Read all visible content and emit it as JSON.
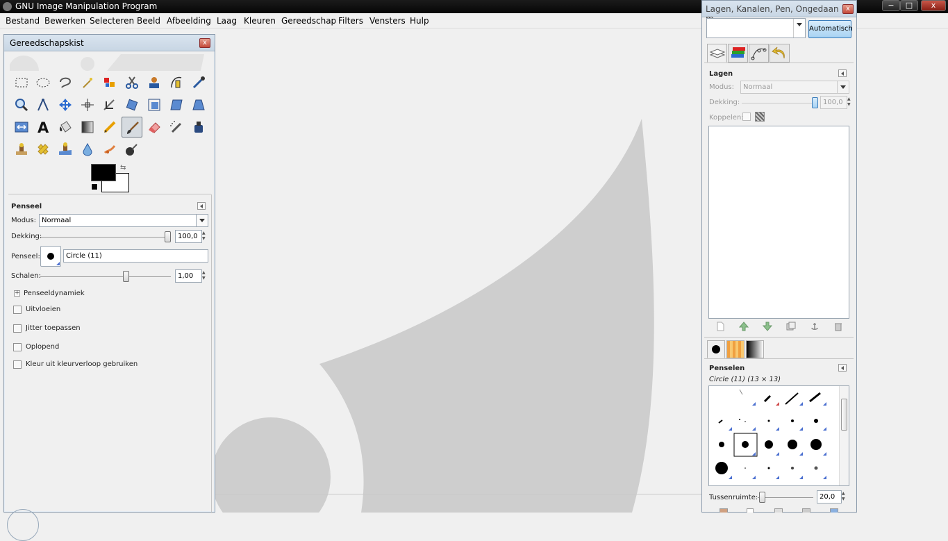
{
  "app": {
    "title": "GNU Image Manipulation Program",
    "window_buttons": {
      "min": "−",
      "max": "□",
      "close": "x"
    }
  },
  "menubar": {
    "items": [
      "Bestand",
      "Bewerken",
      "Selecteren",
      "Beeld",
      "Afbeelding",
      "Laag",
      "Kleuren",
      "Gereedschap",
      "Filters",
      "Vensters",
      "Hulp"
    ]
  },
  "toolbox": {
    "title": "Gereedschapskist",
    "close": "x",
    "active_tool": "paintbrush",
    "tools": [
      "rect-select",
      "ellipse-select",
      "free-select",
      "fuzzy-select",
      "color-select",
      "scissors-select",
      "foreground-select",
      "paths",
      "color-picker",
      "zoom",
      "measure",
      "move",
      "align",
      "crop",
      "rotate",
      "scale",
      "shear",
      "perspective",
      "flip",
      "text",
      "bucket-fill",
      "blend",
      "pencil",
      "paintbrush",
      "eraser",
      "airbrush",
      "ink",
      "clone",
      "heal",
      "perspective-clone",
      "blur-sharpen",
      "smudge",
      "dodge-burn"
    ],
    "colors": {
      "foreground": "#000000",
      "background": "#ffffff"
    }
  },
  "tool_options": {
    "title": "Penseel",
    "mode_label": "Modus:",
    "mode_value": "Normaal",
    "opacity_label": "Dekking:",
    "opacity_value": "100,0",
    "opacity_fraction": 1.0,
    "brush_label": "Penseel:",
    "brush_value": "Circle (11)",
    "scale_label": "Schalen:",
    "scale_value": "1,00",
    "scale_fraction": 0.65,
    "dynamics_label": "Penseeldynamiek",
    "checks": [
      {
        "label": "Uitvloeien",
        "checked": false
      },
      {
        "label": "Jitter toepassen",
        "checked": false
      },
      {
        "label": "Oplopend",
        "checked": false
      },
      {
        "label": "Kleur uit kleurverloop gebruiken",
        "checked": false
      }
    ]
  },
  "dock": {
    "title": "Lagen, Kanalen, Pen, Ongedaan m...",
    "close": "x",
    "auto_button": "Automatisch",
    "tabs": [
      "layers",
      "channels",
      "paths",
      "undo"
    ],
    "layers": {
      "title": "Lagen",
      "mode_label": "Modus:",
      "mode_value": "Normaal",
      "opacity_label": "Dekking:",
      "opacity_value": "100,0",
      "lock_label": "Koppelen:"
    },
    "layer_buttons": [
      "new-layer",
      "raise-layer",
      "lower-layer",
      "duplicate-layer",
      "anchor-layer",
      "delete-layer"
    ],
    "lower_tabs": [
      "brushes",
      "patterns",
      "gradients"
    ],
    "brushes": {
      "title": "Penselen",
      "selected": "Circle (11) (13 × 13)",
      "spacing_label": "Tussenruimte:",
      "spacing_value": "20,0"
    }
  }
}
